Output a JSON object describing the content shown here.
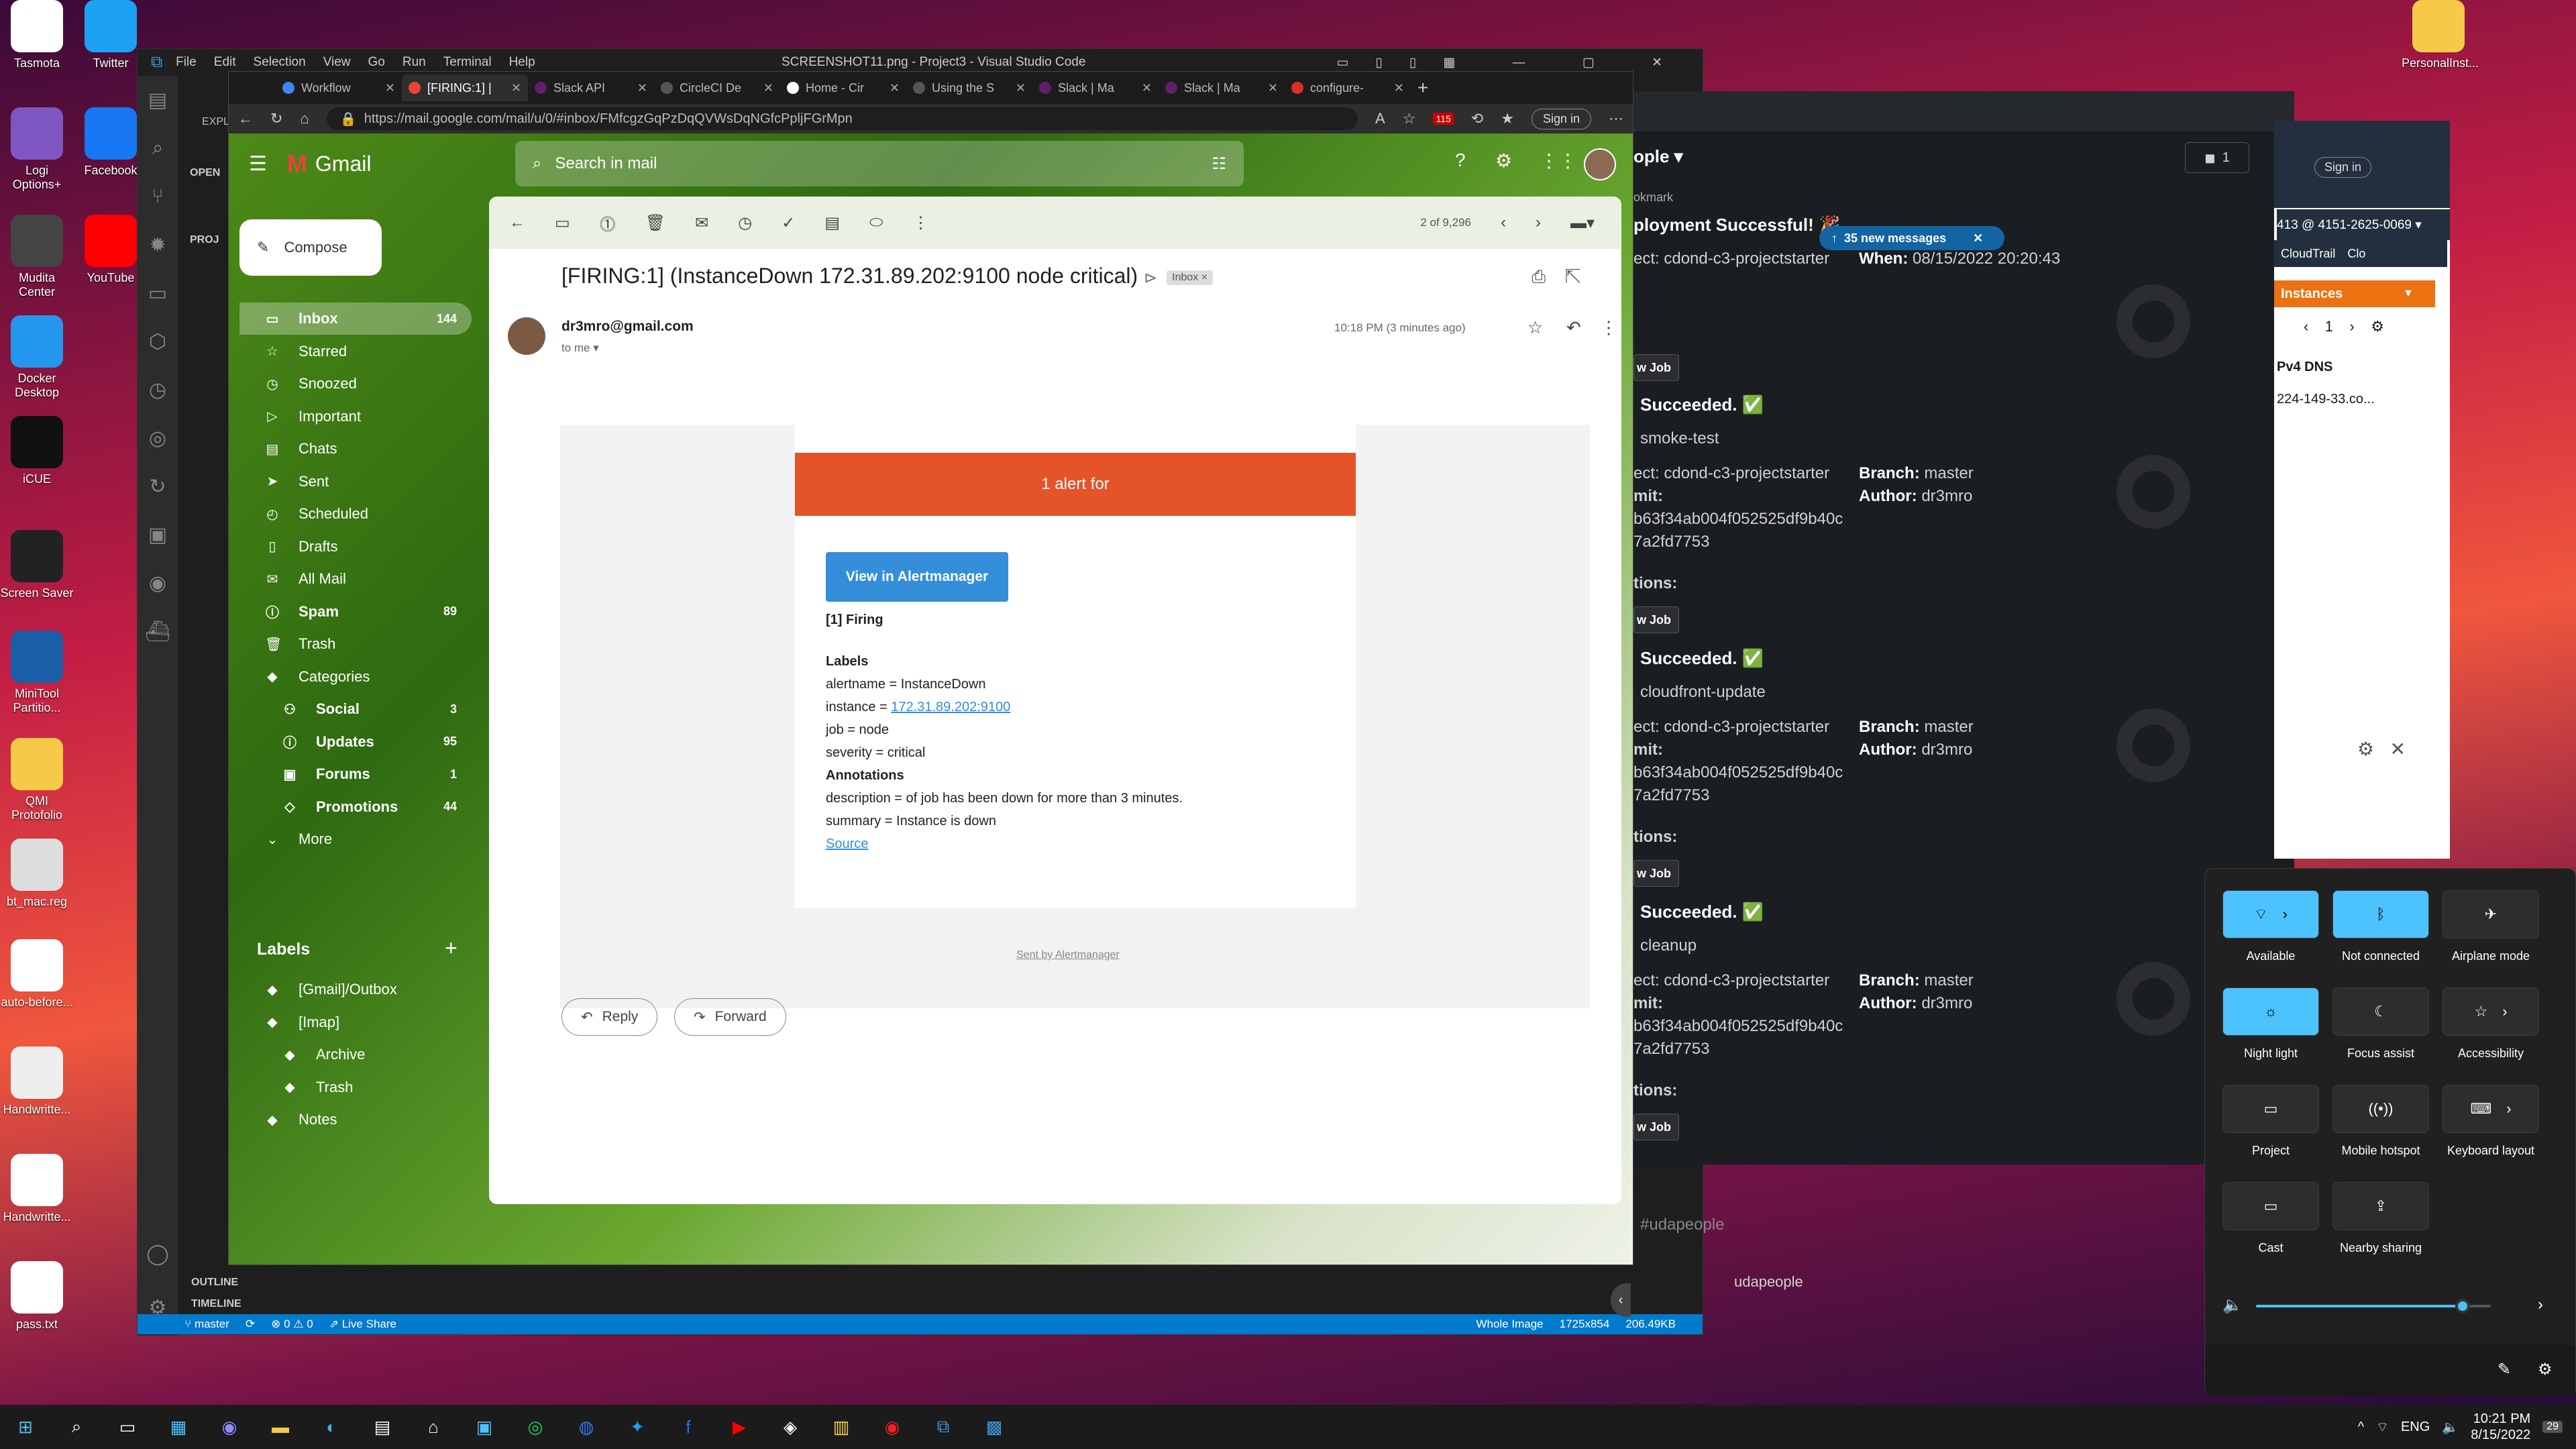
{
  "desktop": {
    "left_icons": [
      "Tasmota",
      "Logi Options+",
      "Mudita Center",
      "Docker Desktop",
      "iCUE",
      "Screen Saver",
      "MiniTool Partitio...",
      "QMI Protofolio",
      "bt_mac.reg",
      "auto-before...",
      "Handwritte...",
      "Handwritte...",
      "pass.txt"
    ],
    "col2_icons": [
      "Twitter",
      "Facebook",
      "YouTube"
    ],
    "right_icons": [
      "PersonalInst..."
    ]
  },
  "vscode": {
    "title": "SCREENSHOT11.png - Project3 - Visual Studio Code",
    "menu": [
      "File",
      "Edit",
      "Selection",
      "View",
      "Go",
      "Run",
      "Terminal",
      "Help"
    ],
    "explorer_head": "EXPL",
    "open_head": "OPEN",
    "proj_head": "PROJ",
    "outline": "OUTLINE",
    "timeline": "TIMELINE",
    "status": {
      "branch": "master",
      "problems": "⊗ 0 ⚠ 0",
      "live_share": "Live Share",
      "image_mode": "Whole Image",
      "dims": "1725x854",
      "size": "206.49KB"
    }
  },
  "browser": {
    "tabs": [
      "Workflow",
      "[FIRING:1] |",
      "Slack API",
      "CircleCI De",
      "Home - Cir",
      "Using the S",
      "Slack | Ma",
      "Slack | Ma",
      "configure-"
    ],
    "url": "https://mail.google.com/mail/u/0/#inbox/FMfcgzGqPzDqQVWsDqNGfcPpljFGrMpn",
    "signin": "Sign in",
    "badge": "115"
  },
  "gmail": {
    "brand": "Gmail",
    "search_placeholder": "Search in mail",
    "compose": "Compose",
    "nav": [
      {
        "label": "Inbox",
        "count": "144",
        "icon": "inbox-icon"
      },
      {
        "label": "Starred",
        "count": "",
        "icon": "star-icon"
      },
      {
        "label": "Snoozed",
        "count": "",
        "icon": "clock-icon"
      },
      {
        "label": "Important",
        "count": "",
        "icon": "important-icon"
      },
      {
        "label": "Chats",
        "count": "",
        "icon": "chat-icon"
      },
      {
        "label": "Sent",
        "count": "",
        "icon": "send-icon"
      },
      {
        "label": "Scheduled",
        "count": "",
        "icon": "scheduled-icon"
      },
      {
        "label": "Drafts",
        "count": "",
        "icon": "draft-icon"
      },
      {
        "label": "All Mail",
        "count": "",
        "icon": "mail-icon"
      },
      {
        "label": "Spam",
        "count": "89",
        "icon": "spam-icon"
      },
      {
        "label": "Trash",
        "count": "",
        "icon": "trash-icon"
      },
      {
        "label": "Categories",
        "count": "",
        "icon": "label-icon"
      },
      {
        "label": "Social",
        "count": "3",
        "icon": "people-icon"
      },
      {
        "label": "Updates",
        "count": "95",
        "icon": "info-icon"
      },
      {
        "label": "Forums",
        "count": "1",
        "icon": "forum-icon"
      },
      {
        "label": "Promotions",
        "count": "44",
        "icon": "tag-icon"
      },
      {
        "label": "More",
        "count": "",
        "icon": "chevron-down-icon"
      }
    ],
    "labels_heading": "Labels",
    "labels": [
      "[Gmail]/Outbox",
      "[Imap]",
      "Archive",
      "Trash",
      "Notes"
    ],
    "mail": {
      "pager": "2 of 9,296",
      "subject": "[FIRING:1] (InstanceDown 172.31.89.202:9100 node critical)",
      "chip": "Inbox ×",
      "sender": "dr3mro@gmail.com",
      "to": "to me ▾",
      "time": "10:18 PM (3 minutes ago)",
      "alert_header": "1 alert for",
      "view_button": "View in Alertmanager",
      "firing": "[1] Firing",
      "labels_title": "Labels",
      "alertname": "alertname = InstanceDown",
      "instance_prefix": "instance = ",
      "instance_link": "172.31.89.202:9100",
      "job": "job = node",
      "severity": "severity = critical",
      "annotations_title": "Annotations",
      "description": "description = of job has been down for more than 3 minutes.",
      "summary": "summary = Instance is down",
      "source": "Source",
      "sent_by": "Sent by Alertmanager",
      "reply": "Reply",
      "forward": "Forward"
    }
  },
  "slack": {
    "channel": "ople ▾",
    "bookmark": "okmark",
    "deploy_title": "ployment Successful! 🎉",
    "project": "ect: cdond-c3-projectstarter",
    "when_label": "When:",
    "when": "08/15/2022 20:20:43",
    "new_messages": "35 new messages",
    "view_job": "w Job",
    "succeeded": "Succeeded. ✅",
    "jobs": [
      "smoke-test",
      "cloudfront-update",
      "cleanup"
    ],
    "branch_label": "Branch:",
    "branch": "master",
    "author_label": "Author:",
    "author": "dr3mro",
    "commit_label": "mit:",
    "commit1": "b63f34ab004f052525df9b40c",
    "commit2": "7a2fd7753",
    "actions": "tions:",
    "composer_placeholder": "#udapeople",
    "huddle": "udapeople",
    "count": "1"
  },
  "aws": {
    "account": "413 @ 4151-2625-0069 ▾",
    "bookmarks": [
      "CloudTrail",
      "Clo"
    ],
    "instances": "Instances",
    "page": "1",
    "dns_header": "Pv4 DNS",
    "dns_value": "224-149-33.co...",
    "signin": "Sign in"
  },
  "quick_settings": {
    "tiles": [
      {
        "label": "Available",
        "on": true,
        "icon": "wifi-icon"
      },
      {
        "label": "Not connected",
        "on": true,
        "icon": "bluetooth-icon"
      },
      {
        "label": "Airplane mode",
        "on": false,
        "icon": "airplane-icon"
      },
      {
        "label": "Night light",
        "on": true,
        "icon": "night-light-icon"
      },
      {
        "label": "Focus assist",
        "on": false,
        "icon": "moon-icon"
      },
      {
        "label": "Accessibility",
        "on": false,
        "icon": "accessibility-icon"
      },
      {
        "label": "Project",
        "on": false,
        "icon": "project-icon"
      },
      {
        "label": "Mobile hotspot",
        "on": false,
        "icon": "hotspot-icon"
      },
      {
        "label": "Keyboard layout",
        "on": false,
        "icon": "keyboard-icon"
      },
      {
        "label": "Cast",
        "on": false,
        "icon": "cast-icon"
      },
      {
        "label": "Nearby sharing",
        "on": false,
        "icon": "share-icon"
      }
    ],
    "volume": 0.88
  },
  "taskbar": {
    "lang": "ENG",
    "time": "10:21 PM",
    "date": "8/15/2022",
    "notif": "29"
  }
}
